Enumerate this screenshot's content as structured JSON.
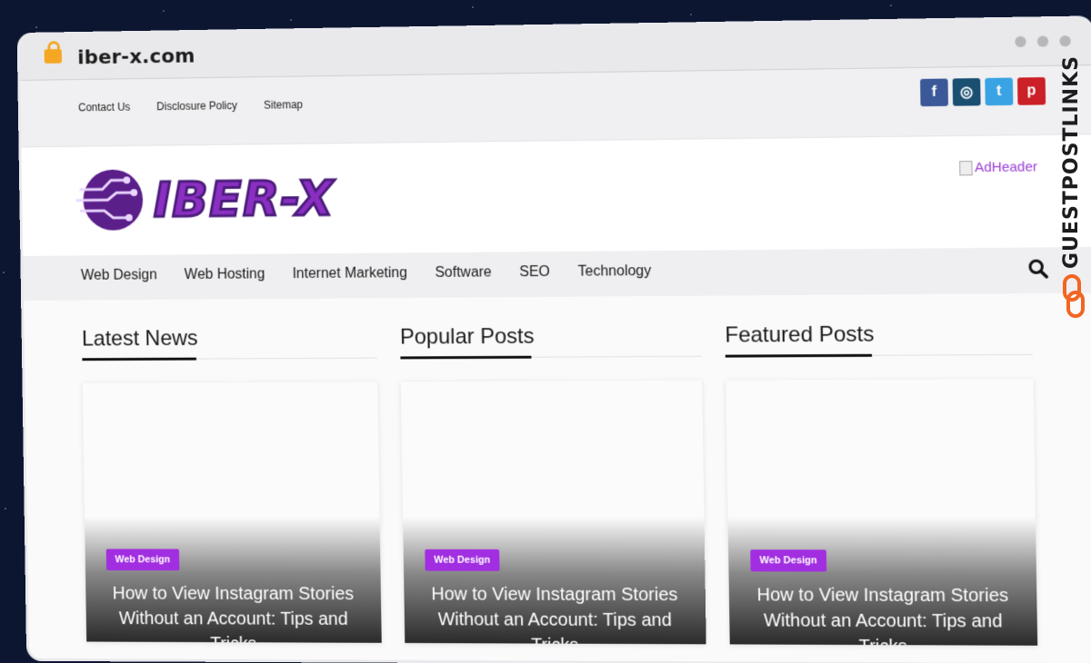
{
  "browser": {
    "url": "iber-x.com"
  },
  "top_links": [
    "Contact Us",
    "Disclosure Policy",
    "Sitemap"
  ],
  "social": [
    {
      "name": "facebook-icon",
      "glyph": "f",
      "color": "#3b5998"
    },
    {
      "name": "instagram-icon",
      "glyph": "◎",
      "color": "#1b4f72"
    },
    {
      "name": "twitter-icon",
      "glyph": "t",
      "color": "#3aa3e3"
    },
    {
      "name": "pinterest-icon",
      "glyph": "p",
      "color": "#cb2027"
    }
  ],
  "logo": {
    "text": "IBER-X",
    "color": "#8a2fc2"
  },
  "ad": {
    "alt": "AdHeader"
  },
  "nav": [
    "Web Design",
    "Web Hosting",
    "Internet Marketing",
    "Software",
    "SEO",
    "Technology"
  ],
  "sections": [
    {
      "heading": "Latest News",
      "card": {
        "category": "Web Design",
        "title": "How to View Instagram Stories Without an Account: Tips and Tricks"
      }
    },
    {
      "heading": "Popular Posts",
      "card": {
        "category": "Web Design",
        "title": "How to View Instagram Stories Without an Account: Tips and Tricks"
      }
    },
    {
      "heading": "Featured Posts",
      "card": {
        "category": "Web Design",
        "title": "How to View Instagram Stories Without an Account: Tips and Tricks"
      }
    }
  ],
  "watermark": {
    "text": "GUESTPOSTLINKS"
  },
  "colors": {
    "accent": "#a12ee0",
    "watermark_orange": "#f26522"
  }
}
